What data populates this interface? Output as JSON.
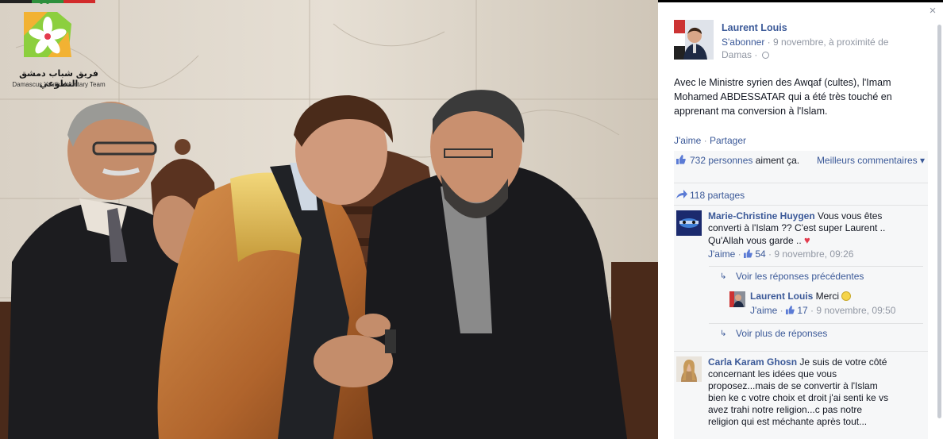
{
  "logo": {
    "arabic_text": "فريق شباب دمشق التطوعي",
    "english_text": "Damascus Youth Voluntary Team"
  },
  "panel": {
    "close_label": "×",
    "author": "Laurent Louis",
    "follow_label": "S'abonner",
    "meta_text": " · 9 novembre, à proximité de Damas · ",
    "post_text": "Avec le Ministre syrien des Awqaf (cultes), l'Imam Mohamed ABDESSATAR qui a été très touché en apprenant ma conversion à l'Islam.",
    "like_label": "J'aime",
    "share_label": "Partager",
    "likes_count_link": "732 personnes",
    "likes_suffix": " aiment ça.",
    "best_comments_label": "Meilleurs commentaires ▾",
    "shares_label": "118 partages",
    "comments": [
      {
        "name": "Marie-Christine Huygen",
        "text": " Vous vous êtes converti à l'Islam ?? C'est super Laurent .. Qu'Allah vous garde .. ",
        "like_label": "J'aime",
        "likes": "54",
        "time": "9 novembre, 09:26"
      },
      {
        "name": "Carla Karam Ghosn",
        "text": " Je suis de votre côté concernant les idées que vous proposez...mais de se convertir à l'Islam bien ke c votre choix et droit j'ai senti ke vs avez trahi notre religion...c pas notre religion qui est méchante après tout..."
      }
    ],
    "previous_replies_label": "Voir les réponses précédentes",
    "more_replies_label": "Voir plus de réponses",
    "reply": {
      "name": "Laurent Louis",
      "text": " Merci ",
      "like_label": "J'aime",
      "likes": "17",
      "time": "9 novembre, 09:50"
    }
  }
}
